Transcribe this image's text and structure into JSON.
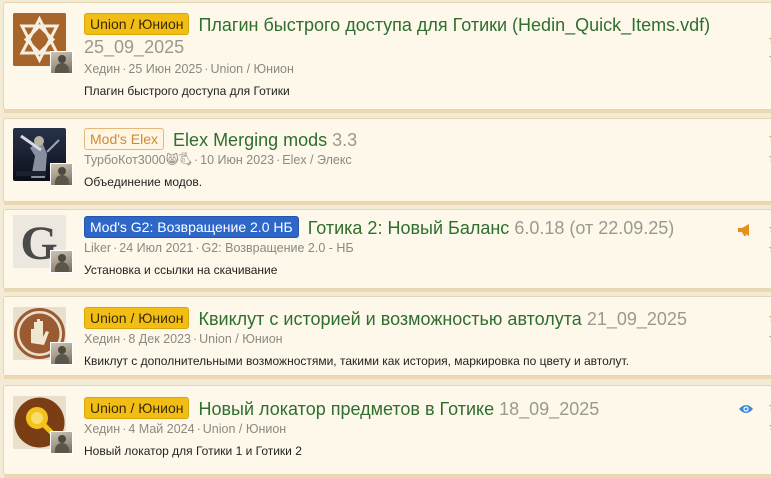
{
  "resources": [
    {
      "badge": "Union / Юнион",
      "badge_style": "union",
      "title": "Плагин быстрого доступа для Готики (Hedin_Quick_Items.vdf)",
      "version": "25_09_2025",
      "author": "Хедин",
      "date": "25 Июн 2025",
      "category": "Union / Юнион",
      "description": "Плагин быстрого доступа для Готики",
      "thumb_icon": "star-knot-logo",
      "side_icon": ""
    },
    {
      "badge": "Mod's Elex",
      "badge_style": "elex",
      "title": "Elex Merging mods",
      "version": "3.3",
      "author": "ТурбоКот3000😸🖏",
      "date": "10 Июн 2023",
      "category": "Elex / Элекс",
      "description": "Объединение модов.",
      "thumb_icon": "warrior-artwork",
      "side_icon": ""
    },
    {
      "badge": "Mod's G2: Возвращение 2.0 НБ",
      "badge_style": "g2",
      "title": "Готика 2: Новый Баланс",
      "version": "6.0.18 (от 22.09.25)",
      "author": "Liker",
      "date": "24 Июл 2021",
      "category": "G2: Возвращение 2.0 - НБ",
      "description": "Установка и ссылки на скачивание",
      "thumb_icon": "gothic-g-logo",
      "side_icon": "megaphone-icon"
    },
    {
      "badge": "Union / Юнион",
      "badge_style": "union",
      "title": "Квиклут с историей и возможностью автолута",
      "version": "21_09_2025",
      "author": "Хедин",
      "date": "8 Дек 2023",
      "category": "Union / Юнион",
      "description": "Квиклут с дополнительными возможностями, такими как история, маркировка по цвету и автолут.",
      "thumb_icon": "hand-icon",
      "side_icon": ""
    },
    {
      "badge": "Union / Юнион",
      "badge_style": "union",
      "title": "Новый локатор предметов в Готике",
      "version": "18_09_2025",
      "author": "Хедин",
      "date": "4 Май 2024",
      "category": "Union / Юнион",
      "description": "Новый локатор для Готики 1 и Готики 2",
      "thumb_icon": "magnifier-icon",
      "side_icon": "eye-icon"
    }
  ],
  "colors": {
    "page_bg": "#f3ebd5",
    "row_bg": "#fdf8ea",
    "title": "#2f6e2f",
    "union_badge": "#f2be16",
    "g2_badge": "#2e67c7",
    "elex_badge_text": "#c98c38"
  }
}
